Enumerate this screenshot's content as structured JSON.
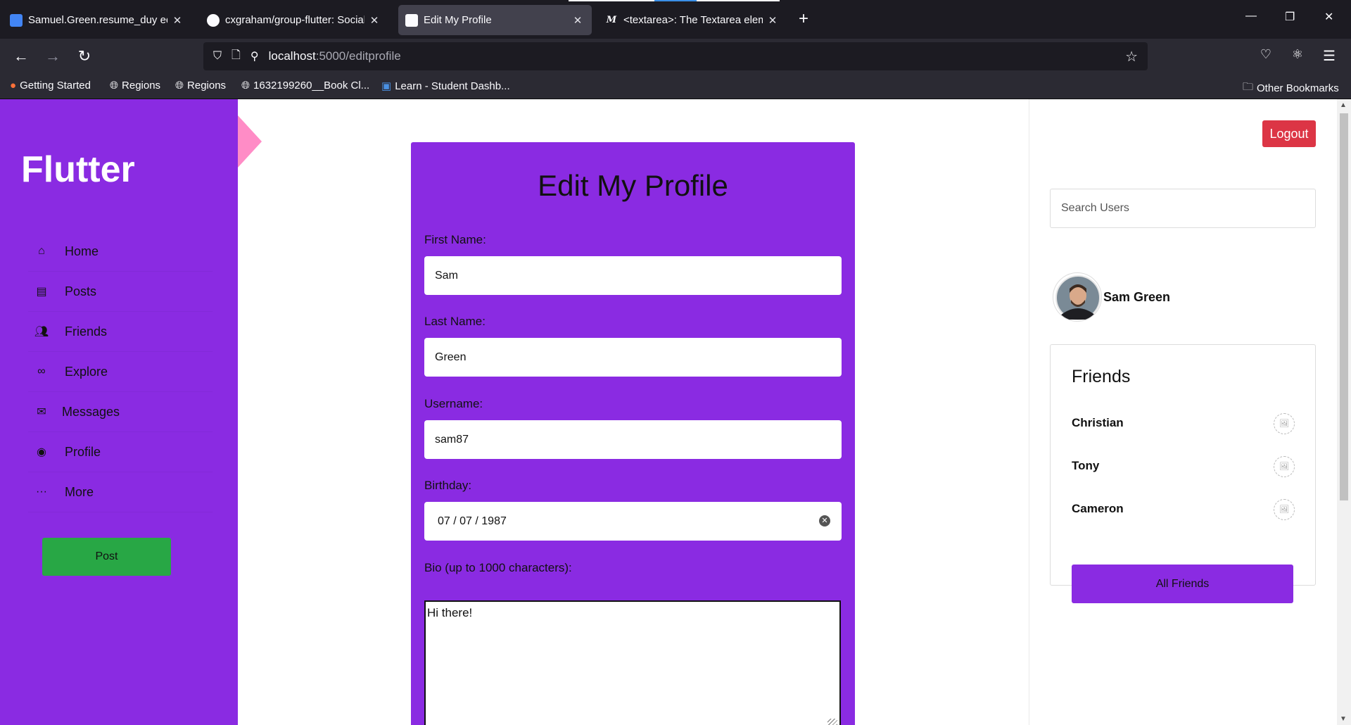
{
  "browser": {
    "tabs": [
      {
        "label": "Samuel.Green.resume_duy edits",
        "icon": "docs-icon",
        "active": false
      },
      {
        "label": "cxgraham/group-flutter: Social",
        "icon": "github-icon",
        "active": false
      },
      {
        "label": "Edit My Profile",
        "icon": "flutter-icon",
        "active": true
      },
      {
        "label": "<textarea>: The Textarea eleme",
        "icon": "mdn-icon",
        "active": false
      }
    ],
    "url_host": "localhost",
    "url_path": ":5000/editprofile",
    "bookmarks": [
      {
        "label": "Getting Started",
        "icon": "firefox-icon"
      },
      {
        "label": "Regions",
        "icon": "globe-icon"
      },
      {
        "label": "Regions",
        "icon": "globe-icon"
      },
      {
        "label": "1632199260__Book Cl...",
        "icon": "globe-icon"
      },
      {
        "label": "Learn - Student Dashb...",
        "icon": "learn-icon"
      }
    ],
    "other_bookmarks": "Other Bookmarks"
  },
  "sidebar": {
    "brand": "Flutter",
    "items": [
      {
        "label": "Home",
        "icon": "home-icon"
      },
      {
        "label": "Posts",
        "icon": "posts-icon"
      },
      {
        "label": "Friends",
        "icon": "friends-icon"
      },
      {
        "label": "Explore",
        "icon": "binoculars-icon"
      },
      {
        "label": "Messages",
        "icon": "envelope-icon"
      },
      {
        "label": "Profile",
        "icon": "user-circle-icon"
      },
      {
        "label": "More",
        "icon": "ellipsis-icon"
      }
    ],
    "post_button": "Post"
  },
  "form": {
    "title": "Edit My Profile",
    "first_name_label": "First Name:",
    "first_name_value": "Sam",
    "last_name_label": "Last Name:",
    "last_name_value": "Green",
    "username_label": "Username:",
    "username_value": "sam87",
    "birthday_label": "Birthday:",
    "birthday_value": "07 / 07 / 1987",
    "bio_label": "Bio (up to 1000 characters):",
    "bio_value": "Hi there!"
  },
  "right": {
    "logout": "Logout",
    "search_placeholder": "Search Users",
    "user_name": "Sam Green",
    "friends_title": "Friends",
    "friends": [
      "Christian",
      "Tony",
      "Cameron"
    ],
    "all_friends": "All Friends"
  },
  "colors": {
    "brand_purple": "#8a2be2",
    "post_green": "#28a745",
    "logout_red": "#dc3545",
    "accent_pink": "#ff8cc6"
  }
}
